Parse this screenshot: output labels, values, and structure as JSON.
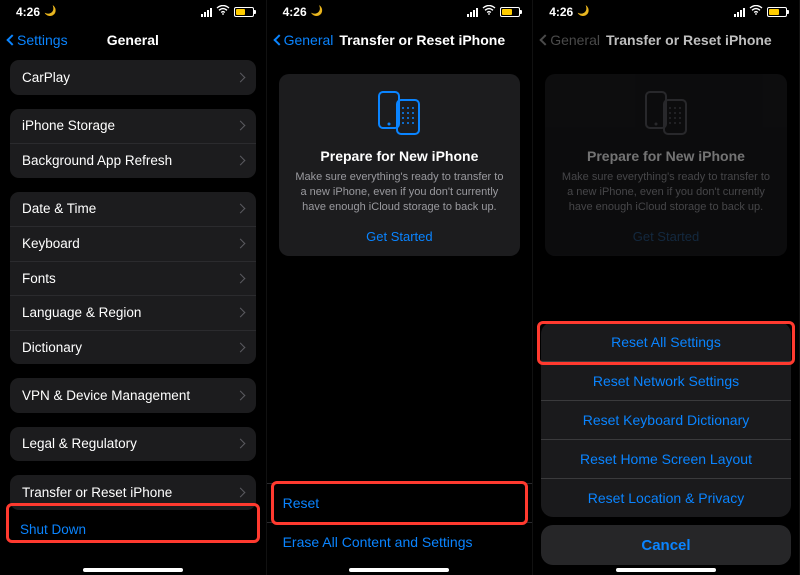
{
  "status": {
    "time": "4:26"
  },
  "panels": [
    {
      "back": "Settings",
      "title": "General",
      "rows": {
        "carplay": "CarPlay",
        "storage": "iPhone Storage",
        "refresh": "Background App Refresh",
        "datetime": "Date & Time",
        "keyboard": "Keyboard",
        "fonts": "Fonts",
        "lang": "Language & Region",
        "dict": "Dictionary",
        "vpn": "VPN & Device Management",
        "legal": "Legal & Regulatory",
        "transfer": "Transfer or Reset iPhone",
        "shutdown": "Shut Down"
      }
    },
    {
      "back": "General",
      "title": "Transfer or Reset iPhone",
      "card": {
        "heading": "Prepare for New iPhone",
        "body": "Make sure everything's ready to transfer to a new iPhone, even if you don't currently have enough iCloud storage to back up.",
        "cta": "Get Started"
      },
      "reset": "Reset",
      "erase": "Erase All Content and Settings"
    },
    {
      "back": "General",
      "title": "Transfer or Reset iPhone",
      "card": {
        "heading": "Prepare for New iPhone",
        "body": "Make sure everything's ready to transfer to a new iPhone, even if you don't currently have enough iCloud storage to back up.",
        "cta": "Get Started"
      },
      "sheet": {
        "all": "Reset All Settings",
        "network": "Reset Network Settings",
        "keyboard": "Reset Keyboard Dictionary",
        "home": "Reset Home Screen Layout",
        "location": "Reset Location & Privacy",
        "cancel": "Cancel"
      }
    }
  ]
}
